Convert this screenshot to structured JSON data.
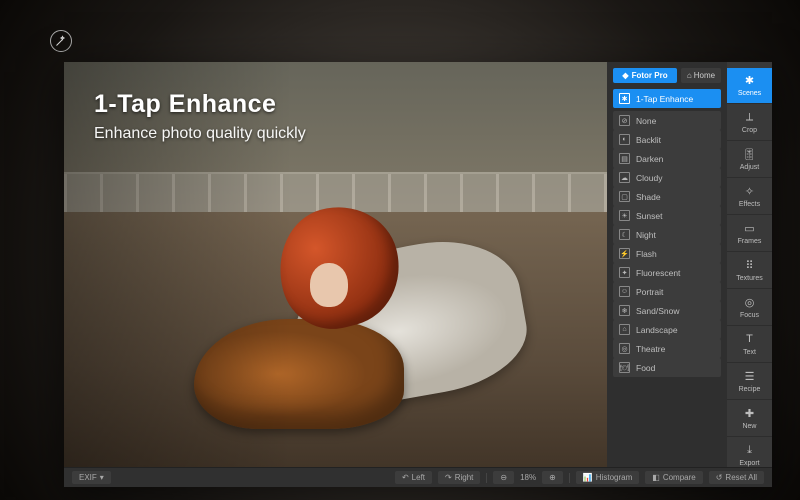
{
  "top_button": {
    "name": "magic-wand"
  },
  "overlay": {
    "title": "1-Tap Enhance",
    "subtitle": "Enhance photo quality quickly"
  },
  "pro_button": {
    "label": "Fotor Pro"
  },
  "home_button": {
    "label": "Home"
  },
  "enhance_list": {
    "header": "1-Tap Enhance",
    "items": [
      {
        "label": "None",
        "glyph": "⊘"
      },
      {
        "label": "Backlit",
        "glyph": "◐"
      },
      {
        "label": "Darken",
        "glyph": "▤"
      },
      {
        "label": "Cloudy",
        "glyph": "☁"
      },
      {
        "label": "Shade",
        "glyph": "▢"
      },
      {
        "label": "Sunset",
        "glyph": "☀"
      },
      {
        "label": "Night",
        "glyph": "☾"
      },
      {
        "label": "Flash",
        "glyph": "⚡"
      },
      {
        "label": "Fluorescent",
        "glyph": "✦"
      },
      {
        "label": "Portrait",
        "glyph": "☺"
      },
      {
        "label": "Sand/Snow",
        "glyph": "❄"
      },
      {
        "label": "Landscape",
        "glyph": "⌂"
      },
      {
        "label": "Theatre",
        "glyph": "◎"
      },
      {
        "label": "Food",
        "glyph": "🍽"
      }
    ]
  },
  "rail": {
    "items": [
      {
        "label": "Scenes",
        "glyph": "✱",
        "name": "rail-scenes",
        "active": true
      },
      {
        "label": "Crop",
        "glyph": "⟂",
        "name": "rail-crop"
      },
      {
        "label": "Adjust",
        "glyph": "🎚",
        "name": "rail-adjust"
      },
      {
        "label": "Effects",
        "glyph": "✧",
        "name": "rail-effects"
      },
      {
        "label": "Frames",
        "glyph": "▭",
        "name": "rail-frames"
      },
      {
        "label": "Textures",
        "glyph": "⠿",
        "name": "rail-textures"
      },
      {
        "label": "Focus",
        "glyph": "◎",
        "name": "rail-focus"
      },
      {
        "label": "Text",
        "glyph": "T",
        "name": "rail-text"
      },
      {
        "label": "Recipe",
        "glyph": "☰",
        "name": "rail-recipe"
      },
      {
        "label": "New",
        "glyph": "✚",
        "name": "rail-new"
      },
      {
        "label": "Export",
        "glyph": "⤓",
        "name": "rail-export"
      }
    ]
  },
  "bottom": {
    "exif": "EXIF",
    "rotate_left": "Left",
    "rotate_right": "Right",
    "zoom": "18%",
    "histogram": "Histogram",
    "compare": "Compare",
    "reset": "Reset All"
  }
}
